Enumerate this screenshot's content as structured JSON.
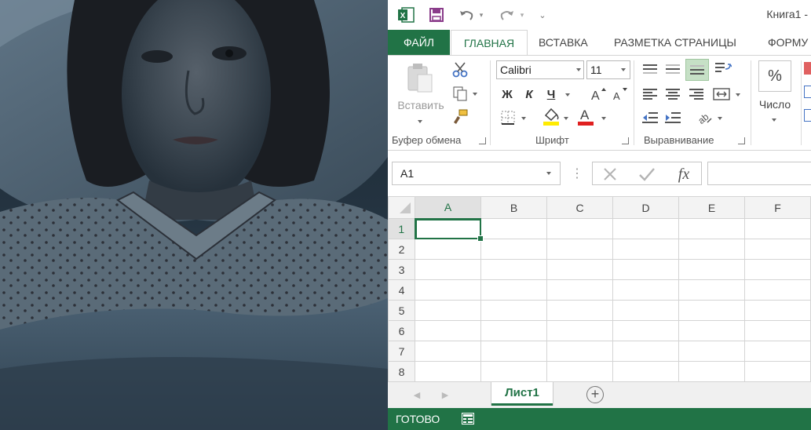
{
  "excel": {
    "title": "Книга1 -",
    "tabs": {
      "file": "ФАЙЛ",
      "home": "ГЛАВНАЯ",
      "insert": "ВСТАВКА",
      "page_layout": "РАЗМЕТКА СТРАНИЦЫ",
      "formulas": "ФОРМУ"
    },
    "clipboard": {
      "paste_label": "Вставить",
      "group_label": "Буфер обмена"
    },
    "font": {
      "name": "Calibri",
      "size": "11",
      "bold": "Ж",
      "italic": "К",
      "underline": "Ч",
      "group_label": "Шрифт"
    },
    "alignment": {
      "group_label": "Выравнивание"
    },
    "number": {
      "percent": "%",
      "label": "Число"
    },
    "name_box": "A1",
    "fx_label": "fx",
    "columns": [
      "A",
      "B",
      "C",
      "D",
      "E",
      "F"
    ],
    "rows": [
      "1",
      "2",
      "3",
      "4",
      "5",
      "6",
      "7",
      "8"
    ],
    "sheet_tab": "Лист1",
    "status": "ГОТОВО",
    "colors": {
      "accent": "#217346",
      "font_color": "#e02020",
      "fill_color": "#ffeb00"
    }
  }
}
